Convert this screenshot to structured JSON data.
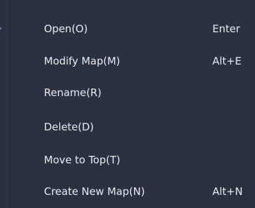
{
  "context_menu": {
    "items": [
      {
        "label": "Open(O)",
        "shortcut": "Enter"
      },
      {
        "label": "Modify Map(M)",
        "shortcut": "Alt+E"
      },
      {
        "label": "Rename(R)",
        "shortcut": ""
      },
      {
        "label": "Delete(D)",
        "shortcut": ""
      },
      {
        "label": "Move to Top(T)",
        "shortcut": ""
      },
      {
        "label": "Create New Map(N)",
        "shortcut": "Alt+N"
      }
    ]
  },
  "colors": {
    "menu_background": "#2a3140",
    "text": "#e8ebf0",
    "hover": "#343c4d"
  }
}
